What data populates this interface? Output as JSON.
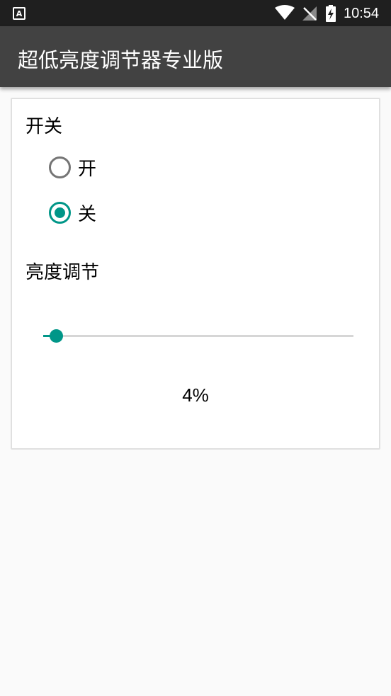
{
  "status_bar": {
    "notification_icon": "A",
    "time": "10:54"
  },
  "app_bar": {
    "title": "超低亮度调节器专业版"
  },
  "switch_section": {
    "label": "开关",
    "options": [
      {
        "label": "开",
        "checked": false
      },
      {
        "label": "关",
        "checked": true
      }
    ]
  },
  "brightness_section": {
    "label": "亮度调节",
    "value": 4,
    "value_text": "4%"
  },
  "colors": {
    "accent": "#009688",
    "app_bar": "#424242",
    "status_bar": "#1f1f1f"
  }
}
